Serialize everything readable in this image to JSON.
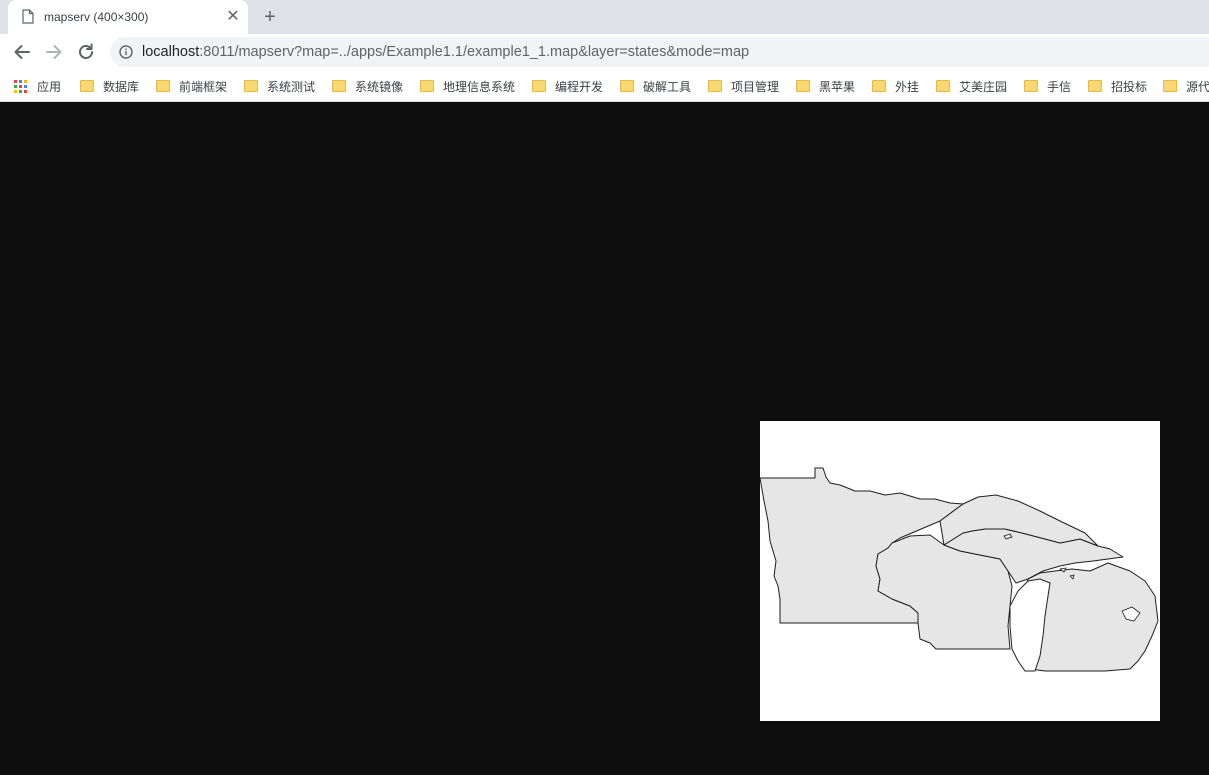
{
  "tab": {
    "title": "mapserv (400×300)",
    "close_glyph": "✕",
    "page_icon": "document-icon"
  },
  "new_tab_glyph": "+",
  "toolbar": {
    "back_icon": "back-arrow-icon",
    "forward_icon": "forward-arrow-icon",
    "reload_icon": "reload-icon"
  },
  "omnibox": {
    "info_icon": "info-icon",
    "url_host": "localhost",
    "url_rest": ":8011/mapserv?map=../apps/Example1.1/example1_1.map&layer=states&mode=map"
  },
  "bookmarks": {
    "apps_label": "应用",
    "items": [
      "数据库",
      "前端框架",
      "系统测试",
      "系统镜像",
      "地理信息系统",
      "编程开发",
      "破解工具",
      "项目管理",
      "黑苹果",
      "外挂",
      "艾美庄园",
      "手信",
      "招投标",
      "源代"
    ]
  },
  "map": {
    "image_size": "400×300",
    "layer": "states",
    "fill_color": "#e6e6e6",
    "outline_color": "#1e1e1e",
    "background_color": "#ffffff"
  }
}
